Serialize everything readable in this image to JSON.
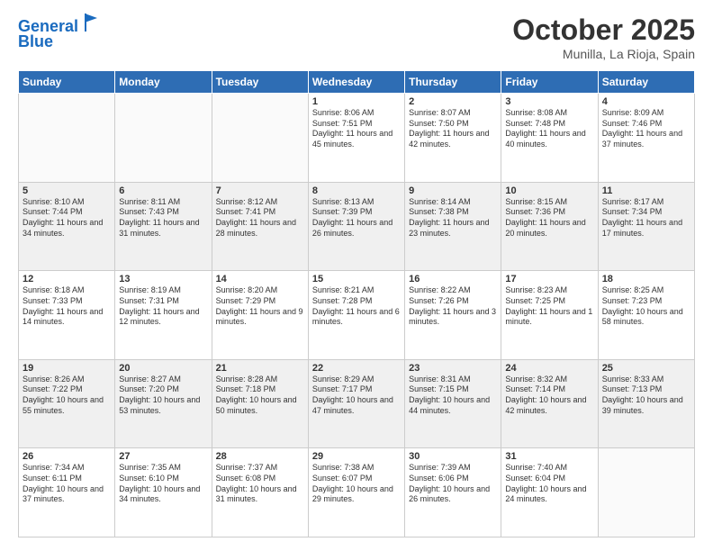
{
  "header": {
    "logo_line1": "General",
    "logo_line2": "Blue",
    "title": "October 2025",
    "subtitle": "Munilla, La Rioja, Spain"
  },
  "weekdays": [
    "Sunday",
    "Monday",
    "Tuesday",
    "Wednesday",
    "Thursday",
    "Friday",
    "Saturday"
  ],
  "weeks": [
    [
      {
        "day": "",
        "info": ""
      },
      {
        "day": "",
        "info": ""
      },
      {
        "day": "",
        "info": ""
      },
      {
        "day": "1",
        "info": "Sunrise: 8:06 AM\nSunset: 7:51 PM\nDaylight: 11 hours and 45 minutes."
      },
      {
        "day": "2",
        "info": "Sunrise: 8:07 AM\nSunset: 7:50 PM\nDaylight: 11 hours and 42 minutes."
      },
      {
        "day": "3",
        "info": "Sunrise: 8:08 AM\nSunset: 7:48 PM\nDaylight: 11 hours and 40 minutes."
      },
      {
        "day": "4",
        "info": "Sunrise: 8:09 AM\nSunset: 7:46 PM\nDaylight: 11 hours and 37 minutes."
      }
    ],
    [
      {
        "day": "5",
        "info": "Sunrise: 8:10 AM\nSunset: 7:44 PM\nDaylight: 11 hours and 34 minutes."
      },
      {
        "day": "6",
        "info": "Sunrise: 8:11 AM\nSunset: 7:43 PM\nDaylight: 11 hours and 31 minutes."
      },
      {
        "day": "7",
        "info": "Sunrise: 8:12 AM\nSunset: 7:41 PM\nDaylight: 11 hours and 28 minutes."
      },
      {
        "day": "8",
        "info": "Sunrise: 8:13 AM\nSunset: 7:39 PM\nDaylight: 11 hours and 26 minutes."
      },
      {
        "day": "9",
        "info": "Sunrise: 8:14 AM\nSunset: 7:38 PM\nDaylight: 11 hours and 23 minutes."
      },
      {
        "day": "10",
        "info": "Sunrise: 8:15 AM\nSunset: 7:36 PM\nDaylight: 11 hours and 20 minutes."
      },
      {
        "day": "11",
        "info": "Sunrise: 8:17 AM\nSunset: 7:34 PM\nDaylight: 11 hours and 17 minutes."
      }
    ],
    [
      {
        "day": "12",
        "info": "Sunrise: 8:18 AM\nSunset: 7:33 PM\nDaylight: 11 hours and 14 minutes."
      },
      {
        "day": "13",
        "info": "Sunrise: 8:19 AM\nSunset: 7:31 PM\nDaylight: 11 hours and 12 minutes."
      },
      {
        "day": "14",
        "info": "Sunrise: 8:20 AM\nSunset: 7:29 PM\nDaylight: 11 hours and 9 minutes."
      },
      {
        "day": "15",
        "info": "Sunrise: 8:21 AM\nSunset: 7:28 PM\nDaylight: 11 hours and 6 minutes."
      },
      {
        "day": "16",
        "info": "Sunrise: 8:22 AM\nSunset: 7:26 PM\nDaylight: 11 hours and 3 minutes."
      },
      {
        "day": "17",
        "info": "Sunrise: 8:23 AM\nSunset: 7:25 PM\nDaylight: 11 hours and 1 minute."
      },
      {
        "day": "18",
        "info": "Sunrise: 8:25 AM\nSunset: 7:23 PM\nDaylight: 10 hours and 58 minutes."
      }
    ],
    [
      {
        "day": "19",
        "info": "Sunrise: 8:26 AM\nSunset: 7:22 PM\nDaylight: 10 hours and 55 minutes."
      },
      {
        "day": "20",
        "info": "Sunrise: 8:27 AM\nSunset: 7:20 PM\nDaylight: 10 hours and 53 minutes."
      },
      {
        "day": "21",
        "info": "Sunrise: 8:28 AM\nSunset: 7:18 PM\nDaylight: 10 hours and 50 minutes."
      },
      {
        "day": "22",
        "info": "Sunrise: 8:29 AM\nSunset: 7:17 PM\nDaylight: 10 hours and 47 minutes."
      },
      {
        "day": "23",
        "info": "Sunrise: 8:31 AM\nSunset: 7:15 PM\nDaylight: 10 hours and 44 minutes."
      },
      {
        "day": "24",
        "info": "Sunrise: 8:32 AM\nSunset: 7:14 PM\nDaylight: 10 hours and 42 minutes."
      },
      {
        "day": "25",
        "info": "Sunrise: 8:33 AM\nSunset: 7:13 PM\nDaylight: 10 hours and 39 minutes."
      }
    ],
    [
      {
        "day": "26",
        "info": "Sunrise: 7:34 AM\nSunset: 6:11 PM\nDaylight: 10 hours and 37 minutes."
      },
      {
        "day": "27",
        "info": "Sunrise: 7:35 AM\nSunset: 6:10 PM\nDaylight: 10 hours and 34 minutes."
      },
      {
        "day": "28",
        "info": "Sunrise: 7:37 AM\nSunset: 6:08 PM\nDaylight: 10 hours and 31 minutes."
      },
      {
        "day": "29",
        "info": "Sunrise: 7:38 AM\nSunset: 6:07 PM\nDaylight: 10 hours and 29 minutes."
      },
      {
        "day": "30",
        "info": "Sunrise: 7:39 AM\nSunset: 6:06 PM\nDaylight: 10 hours and 26 minutes."
      },
      {
        "day": "31",
        "info": "Sunrise: 7:40 AM\nSunset: 6:04 PM\nDaylight: 10 hours and 24 minutes."
      },
      {
        "day": "",
        "info": ""
      }
    ]
  ]
}
